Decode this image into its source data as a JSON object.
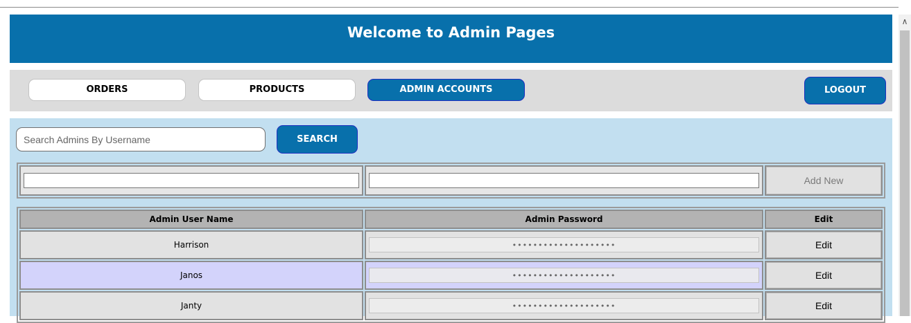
{
  "header": {
    "title": "Welcome to Admin Pages"
  },
  "nav": {
    "orders": "ORDERS",
    "products": "PRODUCTS",
    "admin_accounts": "ADMIN ACCOUNTS",
    "logout": "LOGOUT",
    "active": "admin_accounts"
  },
  "search": {
    "placeholder": "Search Admins By Username",
    "button": "SEARCH"
  },
  "add_form": {
    "username_value": "",
    "password_value": "",
    "button": "Add New"
  },
  "table": {
    "headers": [
      "Admin User Name",
      "Admin Password",
      "Edit"
    ],
    "rows": [
      {
        "username": "Harrison",
        "password_mask": "••••••••••••••••••••",
        "edit": "Edit"
      },
      {
        "username": "Janos",
        "password_mask": "••••••••••••••••••••",
        "edit": "Edit"
      },
      {
        "username": "Janty",
        "password_mask": "••••••••••••••••••••",
        "edit": "Edit"
      }
    ]
  },
  "colors": {
    "brand": "#0870ab",
    "nav_bg": "#dcdcdc",
    "content_bg": "#c2dff0",
    "row_highlight": "#d3d3fb"
  },
  "icons": {
    "scroll_up": "chevron-up-icon"
  }
}
